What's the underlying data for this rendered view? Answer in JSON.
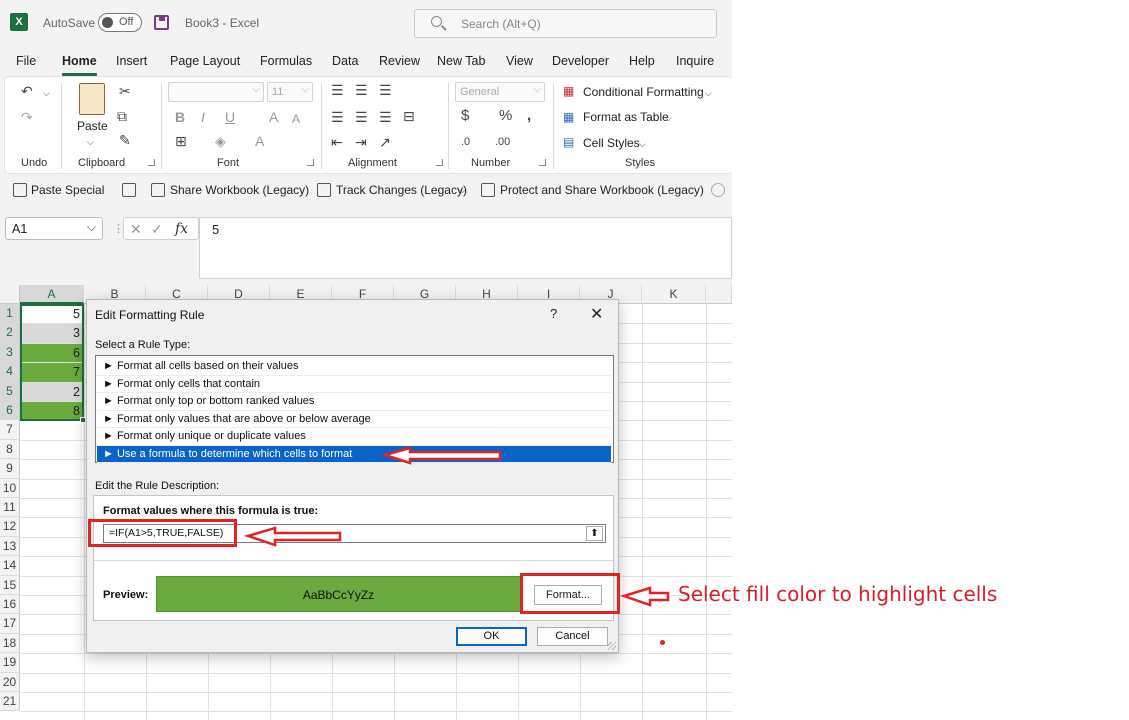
{
  "titlebar": {
    "autosave_label": "AutoSave",
    "autosave_state": "Off",
    "doc_title": "Book3  -  Excel",
    "search_placeholder": "Search (Alt+Q)"
  },
  "menu": [
    "File",
    "Home",
    "Insert",
    "Page Layout",
    "Formulas",
    "Data",
    "Review",
    "New Tab",
    "View",
    "Developer",
    "Help",
    "Inquire"
  ],
  "menu_active": "Home",
  "ribbon": {
    "undo_label": "Undo",
    "paste_label": "Paste",
    "clipboard_label": "Clipboard",
    "font_label": "Font",
    "font_size": "11",
    "alignment_label": "Alignment",
    "number_format": "General",
    "number_label": "Number",
    "styles_label": "Styles",
    "conditional_formatting": "Conditional Formatting",
    "format_as_table": "Format as Table",
    "cell_styles": "Cell Styles"
  },
  "qat": {
    "paste_special": "Paste Special",
    "share_workbook": "Share Workbook (Legacy)",
    "track_changes": "Track Changes (Legacy)",
    "protect_share": "Protect and Share Workbook (Legacy)"
  },
  "formula_bar": {
    "name_box": "A1",
    "fx": "fx",
    "value": "5"
  },
  "columns": [
    "A",
    "B",
    "C",
    "D",
    "E",
    "F",
    "G",
    "H",
    "I",
    "J",
    "K"
  ],
  "rows": [
    "1",
    "2",
    "3",
    "4",
    "5",
    "6",
    "7",
    "8",
    "9",
    "10",
    "11",
    "12",
    "13",
    "14",
    "15",
    "16",
    "17",
    "18",
    "19",
    "20",
    "21"
  ],
  "cells_a": [
    {
      "value": "5",
      "highlight": false
    },
    {
      "value": "3",
      "highlight": false
    },
    {
      "value": "6",
      "highlight": true
    },
    {
      "value": "7",
      "highlight": true
    },
    {
      "value": "2",
      "highlight": false
    },
    {
      "value": "8",
      "highlight": true
    }
  ],
  "colors": {
    "highlight_fill": "#6aaa3f",
    "excel_green": "#1d6f42",
    "annotation_red": "#e02424"
  },
  "dialog": {
    "title": "Edit Formatting Rule",
    "help": "?",
    "close": "✕",
    "rule_type_label": "Select a Rule Type:",
    "rule_types": [
      "► Format all cells based on their values",
      "► Format only cells that contain",
      "► Format only top or bottom ranked values",
      "► Format only values that are above or below average",
      "► Format only unique or duplicate values",
      "► Use a formula to determine which cells to format"
    ],
    "selected_rule_index": 5,
    "description_label": "Edit the Rule Description:",
    "formula_label": "Format values where this formula is true:",
    "formula": "=IF(A1>5,TRUE,FALSE)",
    "preview_label": "Preview:",
    "preview_text": "AaBbCcYyZz",
    "format_button": "Format...",
    "ok_button": "OK",
    "cancel_button": "Cancel"
  },
  "annotation": {
    "text": "Select fill color to highlight cells"
  }
}
